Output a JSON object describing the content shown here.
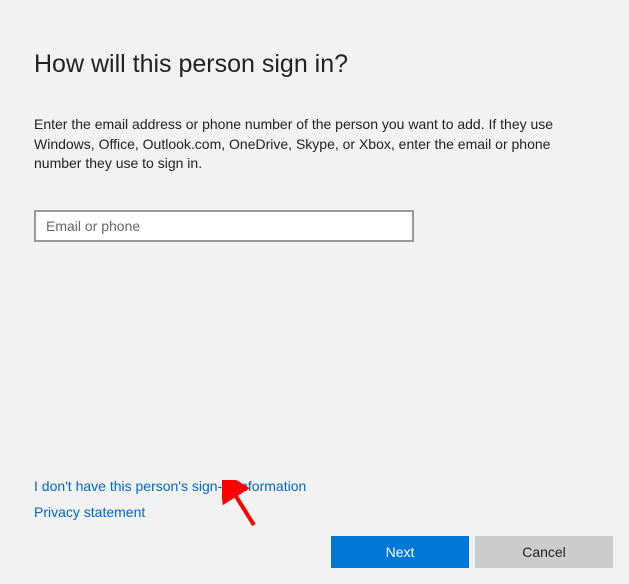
{
  "title": "How will this person sign in?",
  "description": "Enter the email address or phone number of the person you want to add. If they use Windows, Office, Outlook.com, OneDrive, Skype, or Xbox, enter the email or phone number they use to sign in.",
  "input": {
    "placeholder": "Email or phone",
    "value": ""
  },
  "links": {
    "no_info": "I don't have this person's sign-in information",
    "privacy": "Privacy statement"
  },
  "buttons": {
    "next": "Next",
    "cancel": "Cancel"
  }
}
